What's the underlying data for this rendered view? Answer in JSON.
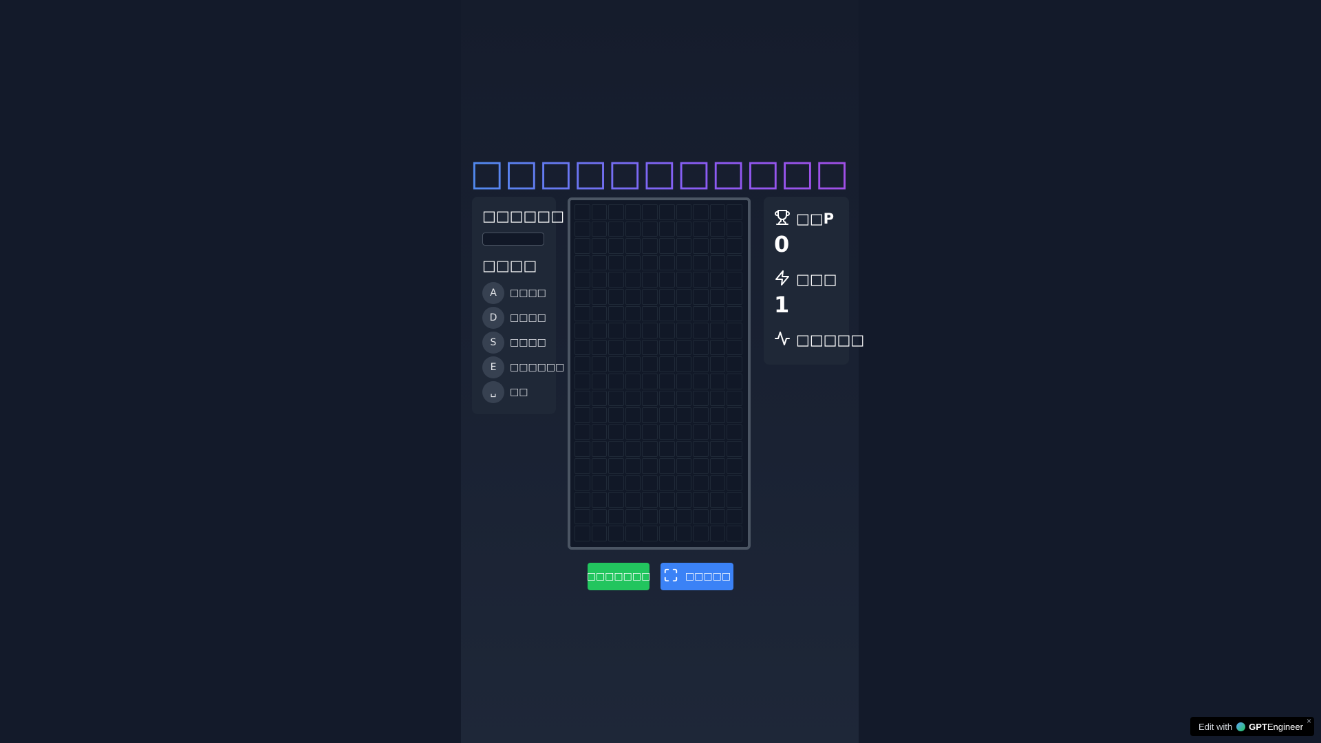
{
  "title": "□□□□□□□□□□□",
  "next_piece": {
    "heading": "□□□□□□"
  },
  "controls": {
    "heading": "□□□□",
    "items": [
      {
        "key": "A",
        "label": "□□□□"
      },
      {
        "key": "D",
        "label": "□□□□"
      },
      {
        "key": "S",
        "label": "□□□□"
      },
      {
        "key": "E",
        "label": "□□□□□□"
      },
      {
        "key": "␣",
        "label": "□□"
      }
    ]
  },
  "stats": {
    "score": {
      "icon": "trophy-icon",
      "label": "□□P",
      "value": "0"
    },
    "level": {
      "icon": "zap-icon",
      "label": "□□□",
      "value": "1"
    },
    "activity": {
      "icon": "activity-icon",
      "label": "□□□□□"
    }
  },
  "board": {
    "columns": 10,
    "rows": 20
  },
  "buttons": {
    "start": "□□□□□□□",
    "fullscreen": "□□□□□"
  },
  "badge": {
    "prefix": "Edit with",
    "brand_bold": "GPT",
    "brand_rest": "Engineer",
    "close": "×"
  },
  "colors": {
    "background": "#131a2a",
    "panel": "#1f2837",
    "start_button": "#22c55e",
    "fullscreen_button": "#3b82f6",
    "title_gradient_start": "#4f8df0",
    "title_gradient_end": "#a34ee6"
  }
}
